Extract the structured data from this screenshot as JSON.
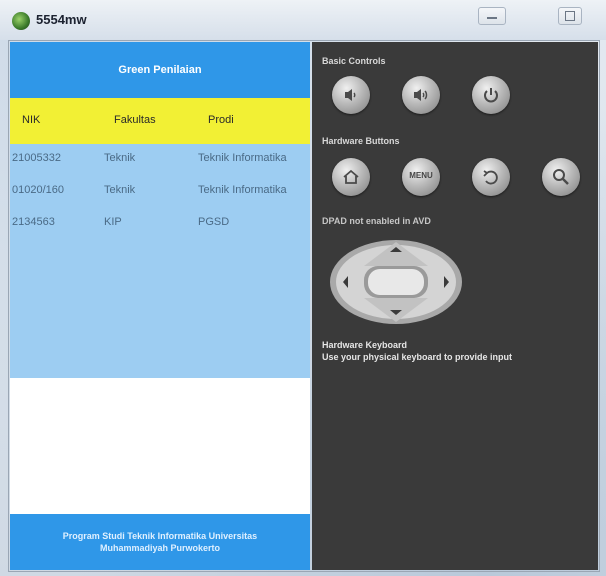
{
  "window": {
    "title": "5554mw"
  },
  "app": {
    "header_title": "Green Penilaian",
    "table": {
      "columns": [
        "NIK",
        "Fakultas",
        "Prodi"
      ],
      "rows": [
        [
          "21005332",
          "Teknik",
          "Teknik Informatika"
        ],
        [
          "01020/160",
          "Teknik",
          "Teknik Informatika"
        ],
        [
          "2134563",
          "KIP",
          "PGSD"
        ]
      ]
    },
    "footer_lines": [
      "Program Studi Teknik Informatika Universitas",
      "Muhammadiyah Purwokerto"
    ]
  },
  "controls": {
    "basic_label": "Basic Controls",
    "basic_buttons": [
      "volume-down-icon",
      "volume-up-icon",
      "power-icon"
    ],
    "hardware_label": "Hardware Buttons",
    "hardware_buttons": [
      "home-icon",
      "menu-icon",
      "back-icon",
      "search-icon"
    ],
    "menu_text": "MENU",
    "dpad_label": "DPAD not enabled in AVD",
    "keyboard_title": "Hardware Keyboard",
    "keyboard_hint": "Use your physical keyboard to provide input"
  },
  "colors": {
    "app_bar": "#2f97e8",
    "table_header": "#f2f034",
    "table_body": "#9dcdf2",
    "panel_bg": "#3a3a3a"
  }
}
